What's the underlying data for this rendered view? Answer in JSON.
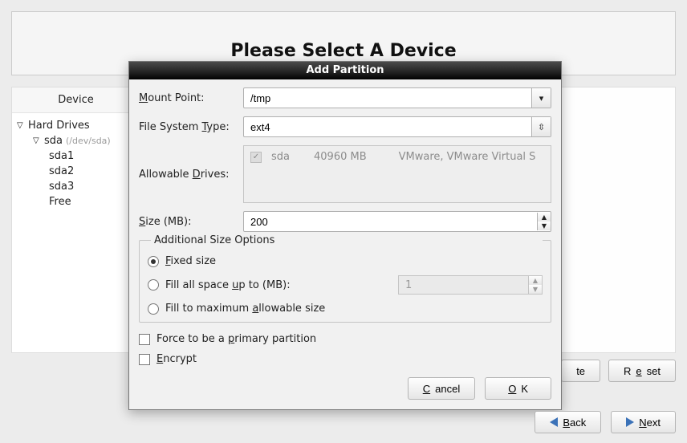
{
  "page_title": "Please Select A Device",
  "sidebar": {
    "header": "Device",
    "hard_drives_label": "Hard Drives",
    "disk": {
      "name": "sda",
      "path": "(/dev/sda)"
    },
    "partitions": [
      "sda1",
      "sda2",
      "sda3",
      "Free"
    ]
  },
  "bg_buttons": {
    "delete": "te",
    "reset_pre": "R",
    "reset_mn": "e",
    "reset_post": "set"
  },
  "footer": {
    "back_mn": "B",
    "back_rest": "ack",
    "next_mn": "N",
    "next_rest": "ext"
  },
  "modal": {
    "title": "Add Partition",
    "labels": {
      "mount_pre": "",
      "mount_mn": "M",
      "mount_post": "ount Point:",
      "fstype_pre": "File System ",
      "fstype_mn": "T",
      "fstype_post": "ype:",
      "drives_pre": "Allowable ",
      "drives_mn": "D",
      "drives_post": "rives:",
      "size_mn": "S",
      "size_post": "ize (MB):",
      "addl": "Additional Size Options"
    },
    "mount_point": "/tmp",
    "fs_type": "ext4",
    "drive": {
      "name": "sda",
      "size": "40960 MB",
      "vendor": "VMware, VMware Virtual S"
    },
    "size_mb": "200",
    "radios": {
      "fixed_mn": "F",
      "fixed_post": "ixed size",
      "fill_up_pre": "Fill all space ",
      "fill_up_mn": "u",
      "fill_up_post": "p to (MB):",
      "fill_up_value": "1",
      "fill_max_pre": "Fill to maximum ",
      "fill_max_mn": "a",
      "fill_max_post": "llowable size"
    },
    "checks": {
      "primary_pre": "Force to be a ",
      "primary_mn": "p",
      "primary_post": "rimary partition",
      "encrypt_mn": "E",
      "encrypt_post": "ncrypt"
    },
    "actions": {
      "cancel_mn": "C",
      "cancel_post": "ancel",
      "ok_mn": "O",
      "ok_post": "K"
    }
  }
}
